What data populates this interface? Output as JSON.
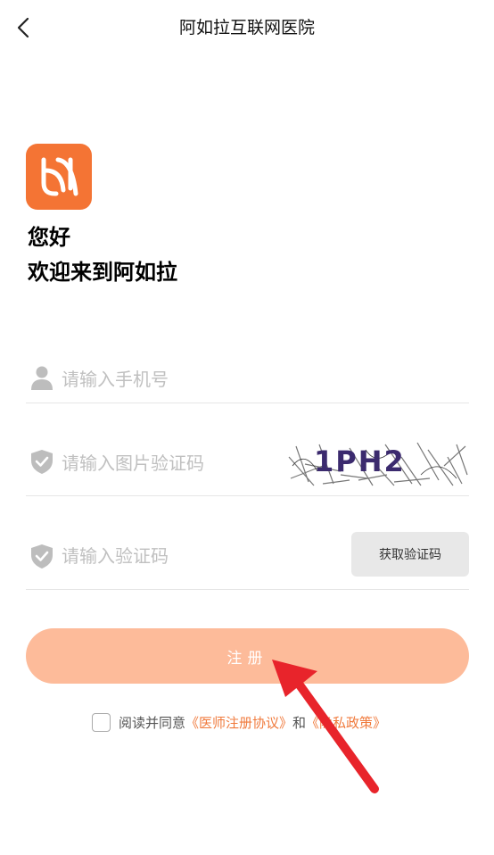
{
  "header": {
    "title": "阿如拉互联网医院",
    "back_icon": "chevron-left-icon"
  },
  "logo": {
    "icon": "arura-logo-icon",
    "color": "#f47434"
  },
  "greeting": {
    "line1": "您好",
    "line2": "欢迎来到阿如拉"
  },
  "form": {
    "phone": {
      "placeholder": "请输入手机号",
      "icon": "user-icon"
    },
    "image_code": {
      "placeholder": "请输入图片验证码",
      "icon": "shield-check-icon",
      "captcha_text": "1PH2"
    },
    "sms_code": {
      "placeholder": "请输入验证码",
      "icon": "shield-check-icon",
      "button_label": "获取验证码"
    }
  },
  "register_button": {
    "label": "注册",
    "color": "#fdbb9a"
  },
  "agreement": {
    "prefix": "阅读并同意",
    "doctor_link": "《医师注册协议》",
    "and": "和",
    "privacy_link": "《隐私政策》"
  },
  "colors": {
    "accent": "#f07a3c",
    "annotation_arrow": "#e8242b"
  }
}
